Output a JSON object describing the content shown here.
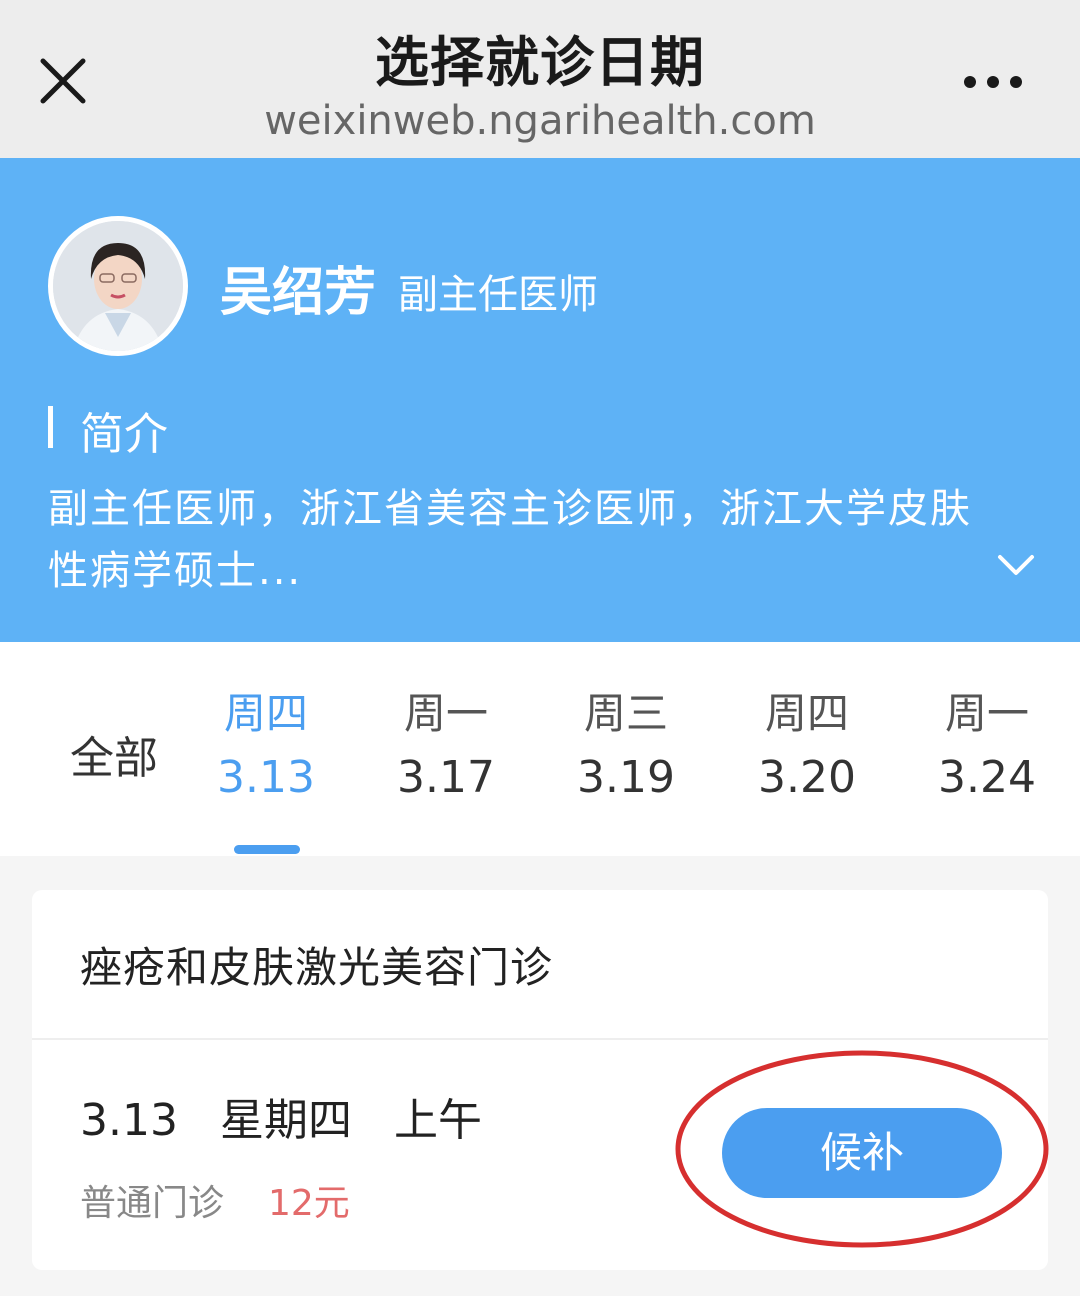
{
  "header": {
    "title": "选择就诊日期",
    "url": "weixinweb.ngarihealth.com",
    "close_icon": "close-icon",
    "more_icon": "more-icon"
  },
  "doctor": {
    "name": "吴绍芳",
    "title": "副主任医师",
    "intro_label": "简介",
    "intro_text": "副主任医师，浙江省美容主诊医师，浙江大学皮肤性病学硕士...",
    "expand_icon": "chevron-down-icon"
  },
  "tabs": {
    "all_label": "全部",
    "dates": [
      {
        "weekday": "周四",
        "date": "3.13",
        "active": true
      },
      {
        "weekday": "周一",
        "date": "3.17"
      },
      {
        "weekday": "周三",
        "date": "3.19"
      },
      {
        "weekday": "周四",
        "date": "3.20"
      },
      {
        "weekday": "周一",
        "date": "3.24"
      }
    ]
  },
  "card": {
    "clinic_name": "痤疮和皮肤激光美容门诊",
    "slot": {
      "date": "3.13",
      "weekday": "星期四",
      "period": "上午",
      "type": "普通门诊",
      "price": "12元",
      "button_label": "候补"
    }
  },
  "colors": {
    "header_bg": "#5eb2f6",
    "accent": "#4b9ef0",
    "price": "#e36b6b",
    "highlight": "#d62f2f"
  }
}
